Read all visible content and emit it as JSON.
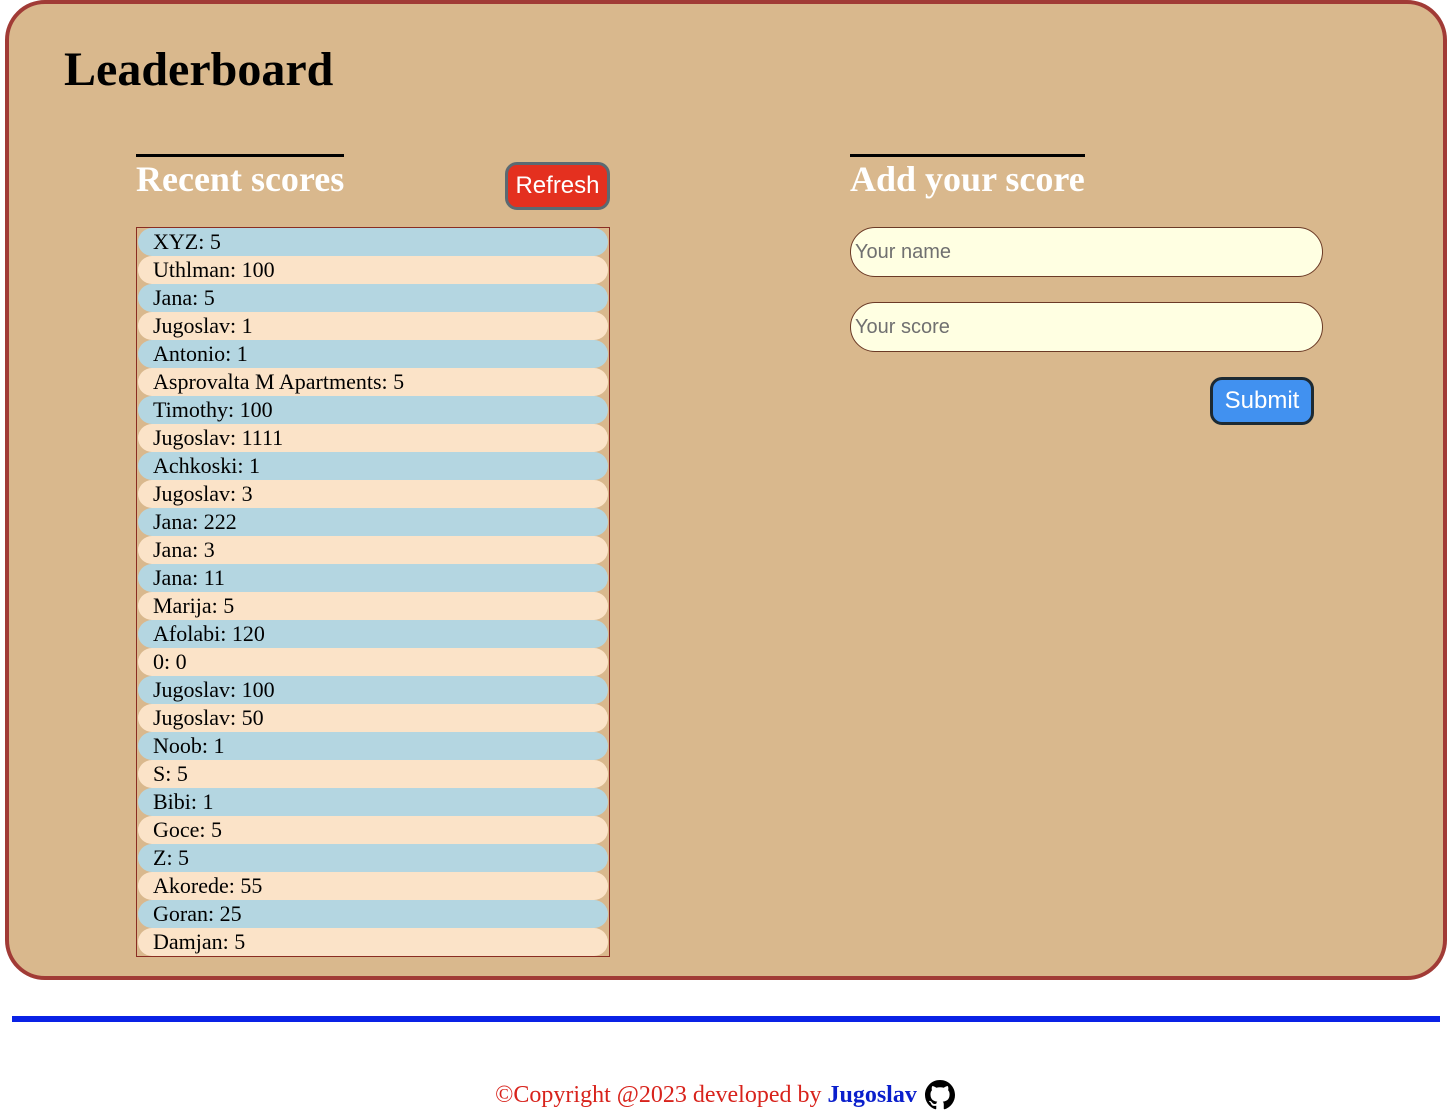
{
  "header": {
    "title": "Leaderboard"
  },
  "recent": {
    "title": "Recent scores",
    "refresh_label": "Refresh",
    "scores": [
      "XYZ: 5",
      "Uthlman: 100",
      "Jana: 5",
      "Jugoslav: 1",
      "Antonio: 1",
      "Asprovalta M Apartments: 5",
      "Timothy: 100",
      "Jugoslav: 1111",
      "Achkoski: 1",
      "Jugoslav: 3",
      "Jana: 222",
      "Jana: 3",
      "Jana: 11",
      "Marija: 5",
      "Afolabi: 120",
      "0: 0",
      "Jugoslav: 100",
      "Jugoslav: 50",
      "Noob: 1",
      "S: 5",
      "Bibi: 1",
      "Goce: 5",
      "Z: 5",
      "Akorede: 55",
      "Goran: 25",
      "Damjan: 5"
    ]
  },
  "add": {
    "title": "Add your score",
    "name_placeholder": "Your name",
    "score_placeholder": "Your score",
    "submit_label": "Submit"
  },
  "footer": {
    "copyright": "©Copyright @2023 developed by ",
    "author": "Jugoslav",
    "icon": "github-icon"
  },
  "colors": {
    "panel_bg": "#d9b88d",
    "panel_border": "#a13b36",
    "refresh_bg": "#e4301f",
    "submit_bg": "#4191f0",
    "row_odd": "#b4d6e1",
    "row_even": "#fbe3c8",
    "divider": "#0a22e6",
    "footer_text": "#d8231c",
    "author_link": "#0a1fcc"
  }
}
